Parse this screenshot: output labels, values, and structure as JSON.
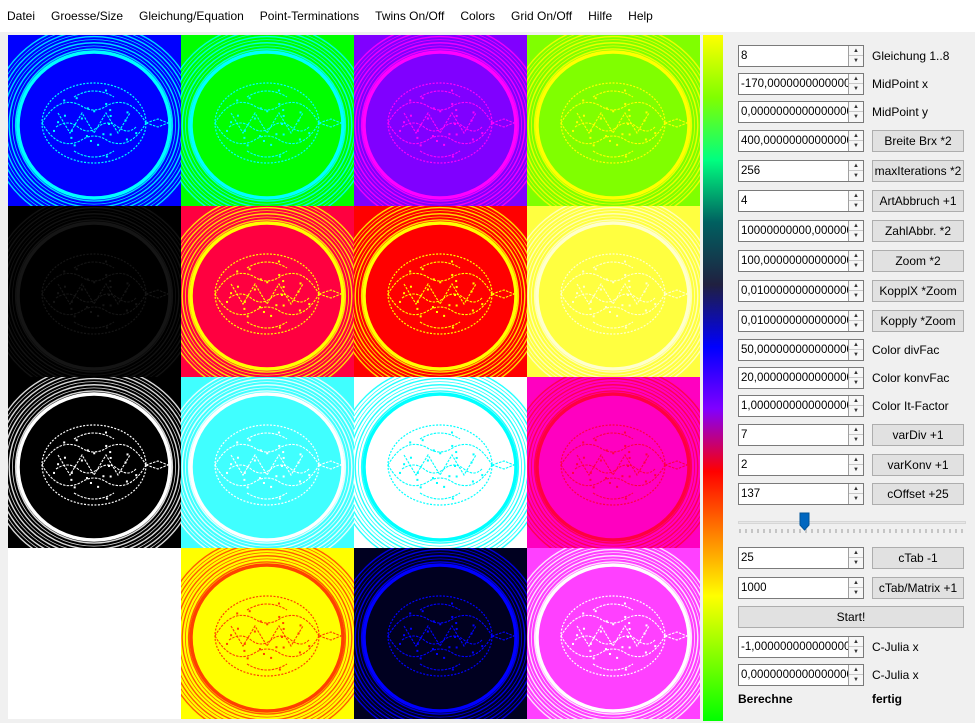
{
  "menu": [
    "Datei",
    "Groesse/Size",
    "Gleichung/Equation",
    "Point-Terminations",
    "Twins On/Off",
    "Colors",
    "Grid On/Off",
    "Hilfe",
    "Help"
  ],
  "tiles": [
    {
      "name": "tile-blue",
      "bg": "#0000ff",
      "fg": "#00ffff"
    },
    {
      "name": "tile-green",
      "bg": "#00ff00",
      "fg": "#00ffff"
    },
    {
      "name": "tile-violet",
      "bg": "#8000ff",
      "fg": "#ff00ff"
    },
    {
      "name": "tile-lime",
      "bg": "#80ff00",
      "fg": "#ffff00"
    },
    {
      "name": "tile-black",
      "bg": "#000000",
      "fg": "#151515"
    },
    {
      "name": "tile-crimson",
      "bg": "#ff0040",
      "fg": "#ffff00"
    },
    {
      "name": "tile-red",
      "bg": "#ff0000",
      "fg": "#ffff00"
    },
    {
      "name": "tile-lightyellow",
      "bg": "#ffff40",
      "fg": "#ffffcc"
    },
    {
      "name": "tile-black-white",
      "bg": "#000000",
      "fg": "#ffffff"
    },
    {
      "name": "tile-cyan",
      "bg": "#40ffff",
      "fg": "#ffffff"
    },
    {
      "name": "tile-white-cyan",
      "bg": "#ffffff",
      "fg": "#00ffff"
    },
    {
      "name": "tile-magenta-red",
      "bg": "#ff00c0",
      "fg": "#ff0040"
    },
    {
      "name": "tile-empty",
      "bg": "#ffffff",
      "fg": "#ffffff"
    },
    {
      "name": "tile-yellow-orange",
      "bg": "#ffff00",
      "fg": "#ff4000"
    },
    {
      "name": "tile-navy",
      "bg": "#000020",
      "fg": "#0000ff"
    },
    {
      "name": "tile-pink-magenta",
      "bg": "#ff40ff",
      "fg": "#ffffff"
    }
  ],
  "palette_colors": [
    "#ffff00",
    "#80ff00",
    "#00ff80",
    "#006060",
    "#202040",
    "#0000ff",
    "#8000ff",
    "#ff0000",
    "#ff8000",
    "#ffff00",
    "#80ff00",
    "#00ff00"
  ],
  "controls": [
    {
      "value": "8",
      "label": "Gleichung 1..8",
      "kind": "label"
    },
    {
      "value": "-170,0000000000000000",
      "label": "MidPoint x",
      "kind": "label"
    },
    {
      "value": "0,0000000000000000",
      "label": "MidPoint y",
      "kind": "label"
    },
    {
      "value": "400,0000000000000000",
      "label": "Breite Brx *2",
      "kind": "button"
    },
    {
      "value": "256",
      "label": "maxIterations *2",
      "kind": "button"
    },
    {
      "value": "4",
      "label": "ArtAbbruch +1",
      "kind": "button"
    },
    {
      "value": "10000000000,0000000",
      "label": "ZahlAbbr. *2",
      "kind": "button"
    },
    {
      "value": "100,0000000000000000",
      "label": "Zoom *2",
      "kind": "button"
    },
    {
      "value": "0,0100000000000000",
      "label": "KopplX *Zoom",
      "kind": "button"
    },
    {
      "value": "0,0100000000000000",
      "label": "Kopply *Zoom",
      "kind": "button"
    },
    {
      "value": "50,0000000000000000",
      "label": "Color divFac",
      "kind": "label"
    },
    {
      "value": "20,0000000000000000",
      "label": "Color konvFac",
      "kind": "label"
    },
    {
      "value": "1,0000000000000000",
      "label": "Color It-Factor",
      "kind": "label"
    },
    {
      "value": "7",
      "label": "varDiv +1",
      "kind": "button"
    },
    {
      "value": "2",
      "label": "varKonv +1",
      "kind": "button"
    },
    {
      "value": "137",
      "label": "cOffset +25",
      "kind": "button"
    }
  ],
  "slider": {
    "value_fraction": 0.28
  },
  "controls_lower": [
    {
      "value": "25",
      "label": "cTab -1",
      "kind": "button"
    },
    {
      "value": "1000",
      "label": "cTab/Matrix +1",
      "kind": "button"
    }
  ],
  "start_label": "Start!",
  "julia": [
    {
      "value": "-1,0000000000000000",
      "label": "C-Julia x"
    },
    {
      "value": "0,0000000000000000",
      "label": "C-Julia x"
    }
  ],
  "status": {
    "left": "Berechne",
    "right": "fertig"
  },
  "accent_color": "#0067c0"
}
